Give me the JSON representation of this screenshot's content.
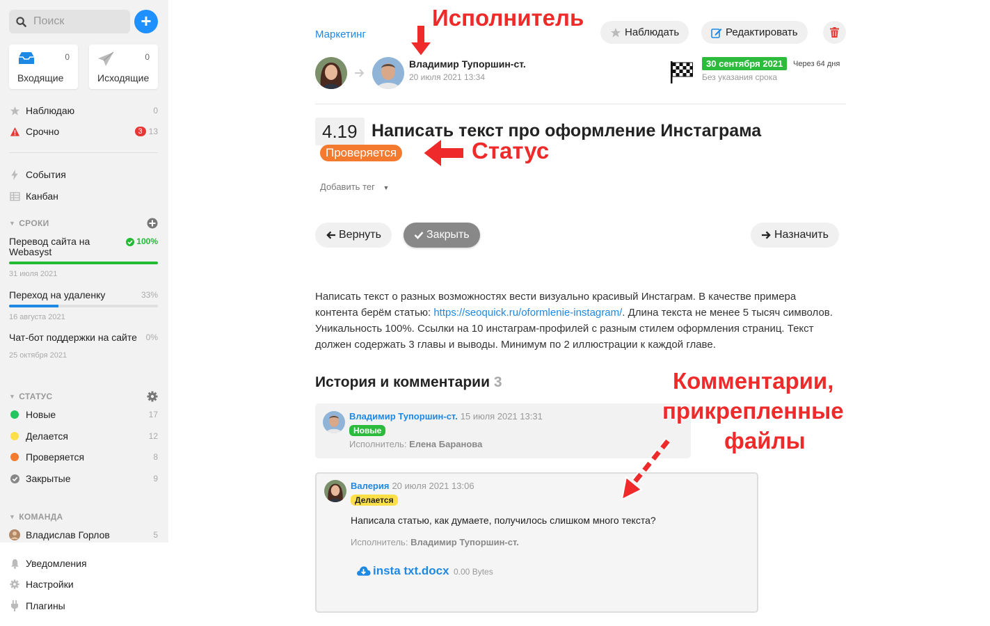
{
  "sidebar": {
    "search_placeholder": "Поиск",
    "add_label": "+",
    "inbox": {
      "label": "Входящие",
      "count": "0"
    },
    "outbox": {
      "label": "Исходящие",
      "count": "0"
    },
    "watch": {
      "label": "Наблюдаю",
      "count": "0"
    },
    "urgent": {
      "label": "Срочно",
      "badge": "3",
      "count": "13"
    },
    "events": {
      "label": "События"
    },
    "kanban": {
      "label": "Канбан"
    },
    "deadlines": {
      "title": "СРОКИ",
      "items": [
        {
          "name": "Перевод сайта на Webasyst",
          "pct": "100%",
          "progress": 100,
          "date": "31 июля 2021",
          "color": "#22bb33"
        },
        {
          "name": "Переход на удаленку",
          "pct": "33%",
          "progress": 33,
          "date": "16 августа 2021",
          "color": "#1e88e5"
        },
        {
          "name": "Чат-бот поддержки на сайте",
          "pct": "0%",
          "progress": 0,
          "date": "25 октября 2021",
          "color": "#1e88e5"
        }
      ]
    },
    "status_section": {
      "title": "СТАТУС",
      "items": [
        {
          "label": "Новые",
          "count": "17",
          "color": "#22c55e"
        },
        {
          "label": "Делается",
          "count": "12",
          "color": "#fde047"
        },
        {
          "label": "Проверяется",
          "count": "8",
          "color": "#f47a30"
        },
        {
          "label": "Закрытые",
          "count": "9",
          "color": "#888888"
        }
      ]
    },
    "team": {
      "title": "КОМАНДА",
      "member": "Владислав Горлов",
      "count": "5"
    },
    "bottom": [
      {
        "label": "Уведомления",
        "icon": "bell-icon"
      },
      {
        "label": "Настройки",
        "icon": "gear-icon"
      },
      {
        "label": "Плагины",
        "icon": "plug-icon"
      }
    ]
  },
  "header": {
    "project": "Маркетинг",
    "watch_button": "Наблюдать",
    "edit_button": "Редактировать",
    "assignee_name": "Владимир Тупоршин-ст.",
    "assignee_date": "20 июля 2021 13:34",
    "due_date": "30 сентября 2021",
    "due_relative": "Через 64 дня",
    "due_note": "Без указания срока"
  },
  "task": {
    "number": "4.19",
    "title": "Написать текст про оформление Инстаграма",
    "status": "Проверяется",
    "add_tag": "Добавить тег",
    "actions": {
      "return": "Вернуть",
      "close": "Закрыть",
      "assign": "Назначить"
    },
    "description_1": "Написать текст о разных возможностях вести визуально красивый Инстаграм. В качестве примера контента берём статью: ",
    "description_link": "https://seoquick.ru/oformlenie-instagram/",
    "description_2": ". Длина текста не менее 5 тысяч символов. Уникальность 100%. Ссылки на 10 инстаграм-профилей с разным стилем оформления страниц. Текст должен содержать 3 главы и выводы. Минимум по 2 иллюстрации к каждой главе."
  },
  "history": {
    "title": "История и комментарии",
    "count": "3",
    "entries": [
      {
        "author": "Владимир Тупоршин-ст.",
        "time": "15 июля 2021 13:31",
        "badge": "Новые",
        "assignee_label": "Исполнитель:",
        "assignee": "Елена Баранова"
      },
      {
        "author": "Валерия",
        "time": "20 июля 2021 13:06",
        "badge": "Делается",
        "text": "Написала статью, как думаете, получилось слишком много текста?",
        "assignee_label": "Исполнитель:",
        "assignee": "Владимир Тупоршин-ст.",
        "file": "insta txt.docx",
        "file_size": "0.00 Bytes"
      }
    ]
  },
  "annotations": {
    "assignee": "Исполнитель",
    "status": "Статус",
    "comments_1": "Комментарии,",
    "comments_2": "прикрепленные",
    "comments_3": "файлы"
  },
  "colors": {
    "accent": "#1e88e5",
    "status_review": "#f47a30",
    "due_green": "#2cbb3c",
    "annotation_red": "#ee2a2a"
  }
}
